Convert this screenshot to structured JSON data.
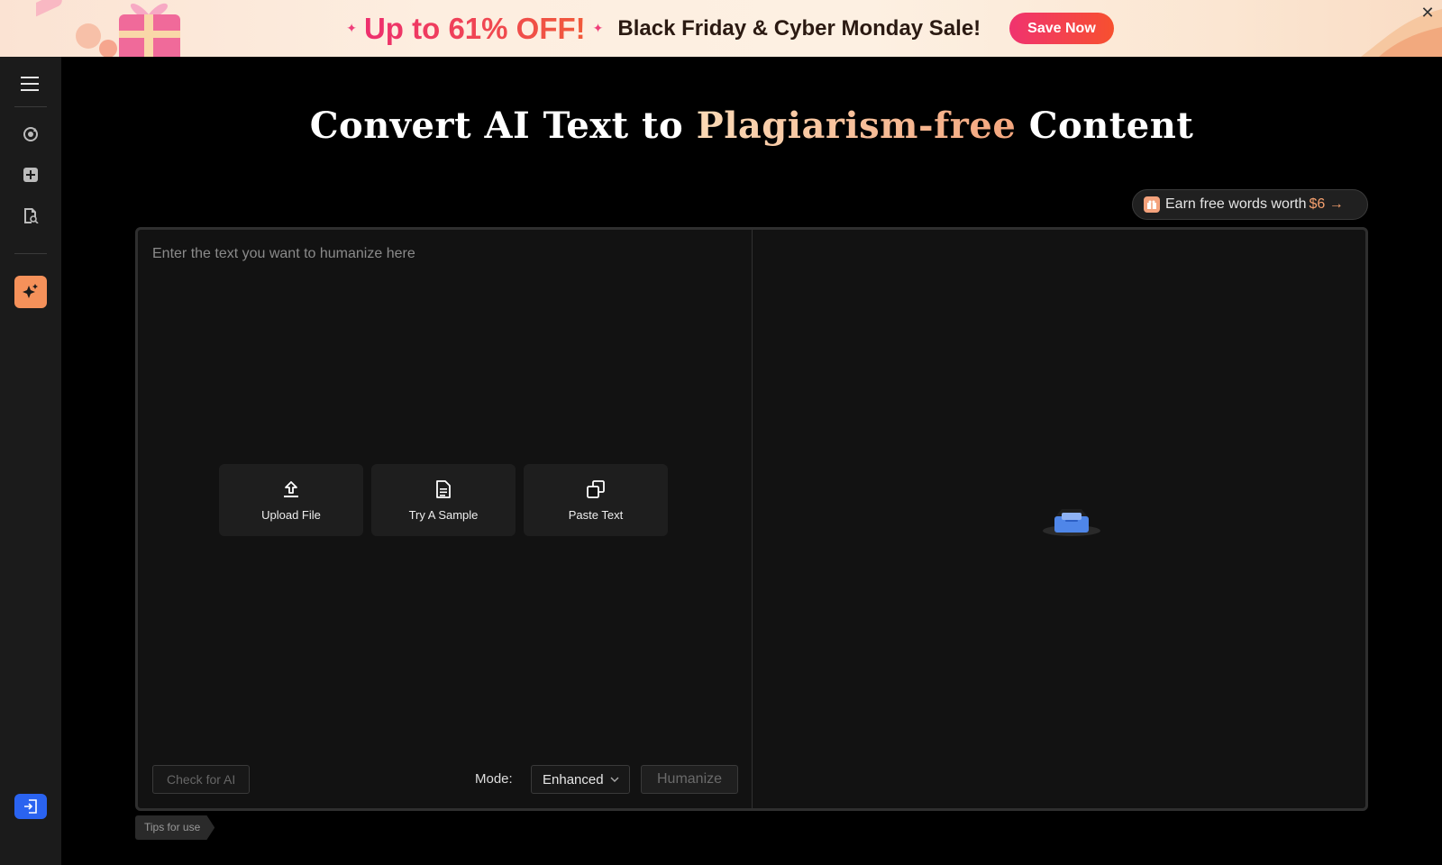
{
  "banner": {
    "promo": "Up to 61% OFF!",
    "sale_text": "Black Friday & Cyber Monday Sale!",
    "cta": "Save Now",
    "close": "✕"
  },
  "header": {
    "title_part1": "Convert AI Text to ",
    "title_accent": "Plagiarism-free",
    "title_part2": " Content"
  },
  "earn": {
    "text": "Earn free words worth",
    "amount": "$6 →"
  },
  "editor": {
    "placeholder": "Enter the text you want to humanize here"
  },
  "actions": [
    {
      "label": "Upload File",
      "icon": "upload-icon"
    },
    {
      "label": "Try A Sample",
      "icon": "document-icon"
    },
    {
      "label": "Paste Text",
      "icon": "copy-icon"
    }
  ],
  "toolbar": {
    "check_label": "Check for AI",
    "mode_label": "Mode:",
    "mode_value": "Enhanced",
    "humanize_label": "Humanize"
  },
  "tips": "Tips for use",
  "colors": {
    "accent": "#f5915a",
    "login": "#2a63f0",
    "banner_cta": "#f0336f"
  }
}
